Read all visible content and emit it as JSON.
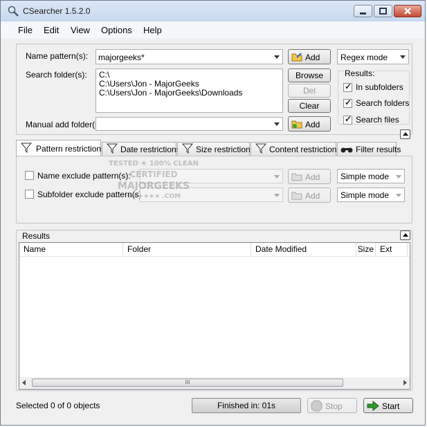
{
  "window": {
    "title": "CSearcher 1.5.2.0"
  },
  "menu": [
    "File",
    "Edit",
    "View",
    "Options",
    "Help"
  ],
  "search": {
    "name_pattern_label": "Name pattern(s):",
    "name_pattern_value": "majorgeeks*",
    "add_label": "Add",
    "mode_value": "Regex mode",
    "search_folder_label": "Search folder(s):",
    "folders": [
      "C:\\",
      "C:\\Users\\Jon - MajorGeeks",
      "C:\\Users\\Jon - MajorGeeks\\Downloads"
    ],
    "browse_label": "Browse",
    "del_label": "Del",
    "clear_label": "Clear",
    "manual_add_label": "Manual add folder(s):",
    "manual_add_button": "Add",
    "results_options_label": "Results:",
    "options": [
      {
        "label": "In subfolders",
        "checked": true
      },
      {
        "label": "Search folders",
        "checked": true
      },
      {
        "label": "Search files",
        "checked": true
      }
    ]
  },
  "tabs": [
    "Pattern restrictions",
    "Date restrictions",
    "Size restrictions",
    "Content restrictions",
    "Filter results"
  ],
  "patterns": {
    "name_exclude_label": "Name exclude pattern(s):",
    "subfolder_exclude_label": "Subfolder exclude pattern(s):",
    "add_label": "Add",
    "mode_value": "Simple mode"
  },
  "watermark": [
    "TESTED ★ 100% CLEAN",
    "CERTIFIED",
    "MAJORGEEKS",
    "★★★★★★ .COM"
  ],
  "results": {
    "label": "Results",
    "columns": [
      "Name",
      "Folder",
      "Date Modified",
      "Size",
      "Ext"
    ],
    "scroll_grip": "III"
  },
  "status": {
    "selected_text": "Selected 0 of 0 objects",
    "progress_text": "Finished in: 01s",
    "stop_label": "Stop",
    "start_label": "Start"
  },
  "colors": {
    "accent": "#3a77d3",
    "start_arrow": "#2e9a2e"
  }
}
